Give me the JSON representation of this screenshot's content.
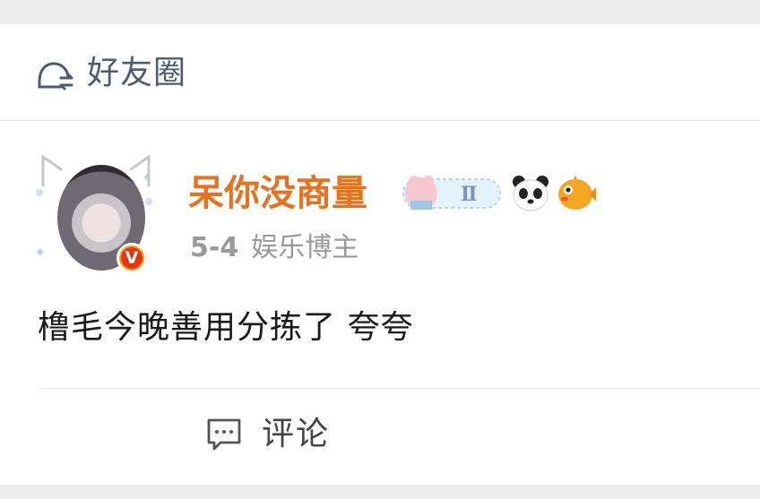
{
  "header": {
    "title": "好友圈",
    "icon": "friends-circle-icon"
  },
  "post": {
    "author": {
      "name": "呆你没商量",
      "verified_badge": "V",
      "badges": [
        "gemini-zodiac-badge",
        "panda-emoji",
        "pufferfish-emoji"
      ]
    },
    "date": "5-4",
    "role": "娱乐博主",
    "text": "橹毛今晚善用分拣了 夸夸",
    "actions": {
      "comment_label": "评论"
    }
  },
  "colors": {
    "username": "#e8711e",
    "header_text": "#4d5a73",
    "meta": "#9a9a9a"
  }
}
